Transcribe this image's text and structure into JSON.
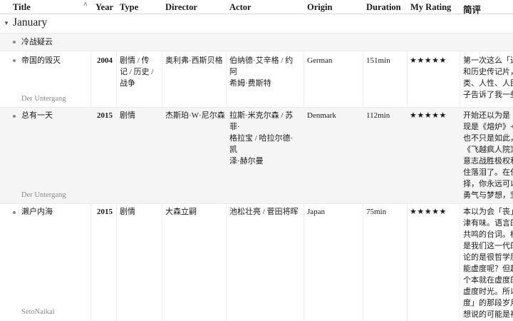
{
  "columns": {
    "title": "Title",
    "year": "Year",
    "type": "Type",
    "director": "Director",
    "actor": "Actor",
    "origin": "Origin",
    "duration": "Duration",
    "rating": "My Rating",
    "review": "简评"
  },
  "group": {
    "label": "January"
  },
  "rows": [
    {
      "title": "冷战疑云"
    },
    {
      "title": "帝国的毁灭",
      "year": "2004",
      "type": [
        "剧情 / 传",
        "记 / 历史 /",
        "战争"
      ],
      "director": "奥利弗·西斯贝格",
      "actor": [
        "伯纳德·艾辛格 / 约阿",
        "希姆·费斯特"
      ],
      "origin": "German",
      "duration": "151min",
      "rating": "★★★★★",
      "review": [
        "第一次这么「近",
        "和历史传记片，",
        "类、人性、人民",
        "子告诉了我一些"
      ],
      "subtitle": "Der Untergang"
    },
    {
      "title": "总有一天",
      "year": "2015",
      "type": [
        "剧情"
      ],
      "director": "杰斯珀·W·尼尔森",
      "actor": [
        "拉斯·米克尔森 / 苏菲·",
        "格拉宝 / 哈拉尔德·凯",
        "泽·赫尔曼"
      ],
      "origin": "Denmark",
      "duration": "112min",
      "rating": "★★★★★",
      "review": [
        "开始还以为是《",
        "现是《熔炉》+",
        "也不只是如此，",
        "《飞越疯人院》",
        "意志战胜极权和",
        "住落泪了。在任",
        "择，你永远可以",
        "勇气与梦想，坚"
      ],
      "subtitle": "Der Untergang"
    },
    {
      "title": "濑户内海",
      "year": "2015",
      "type": [
        "剧情"
      ],
      "director": "大森立嗣",
      "actor": [
        "池松壮亮 / 菅田将晖"
      ],
      "origin": "Japan",
      "duration": "75min",
      "rating": "★★★★★",
      "review": [
        "本以为会「丧」",
        "津有味。语言的",
        "共鸣的台词。模",
        "是我们这一代的",
        "论的是很哲学层",
        "能虚度呢？但超",
        "个本就在虚度的",
        "虚度时光。所以",
        "度」的那段岁月",
        "想说的可能是神"
      ],
      "subtitle": "SetoNaikai"
    }
  ]
}
